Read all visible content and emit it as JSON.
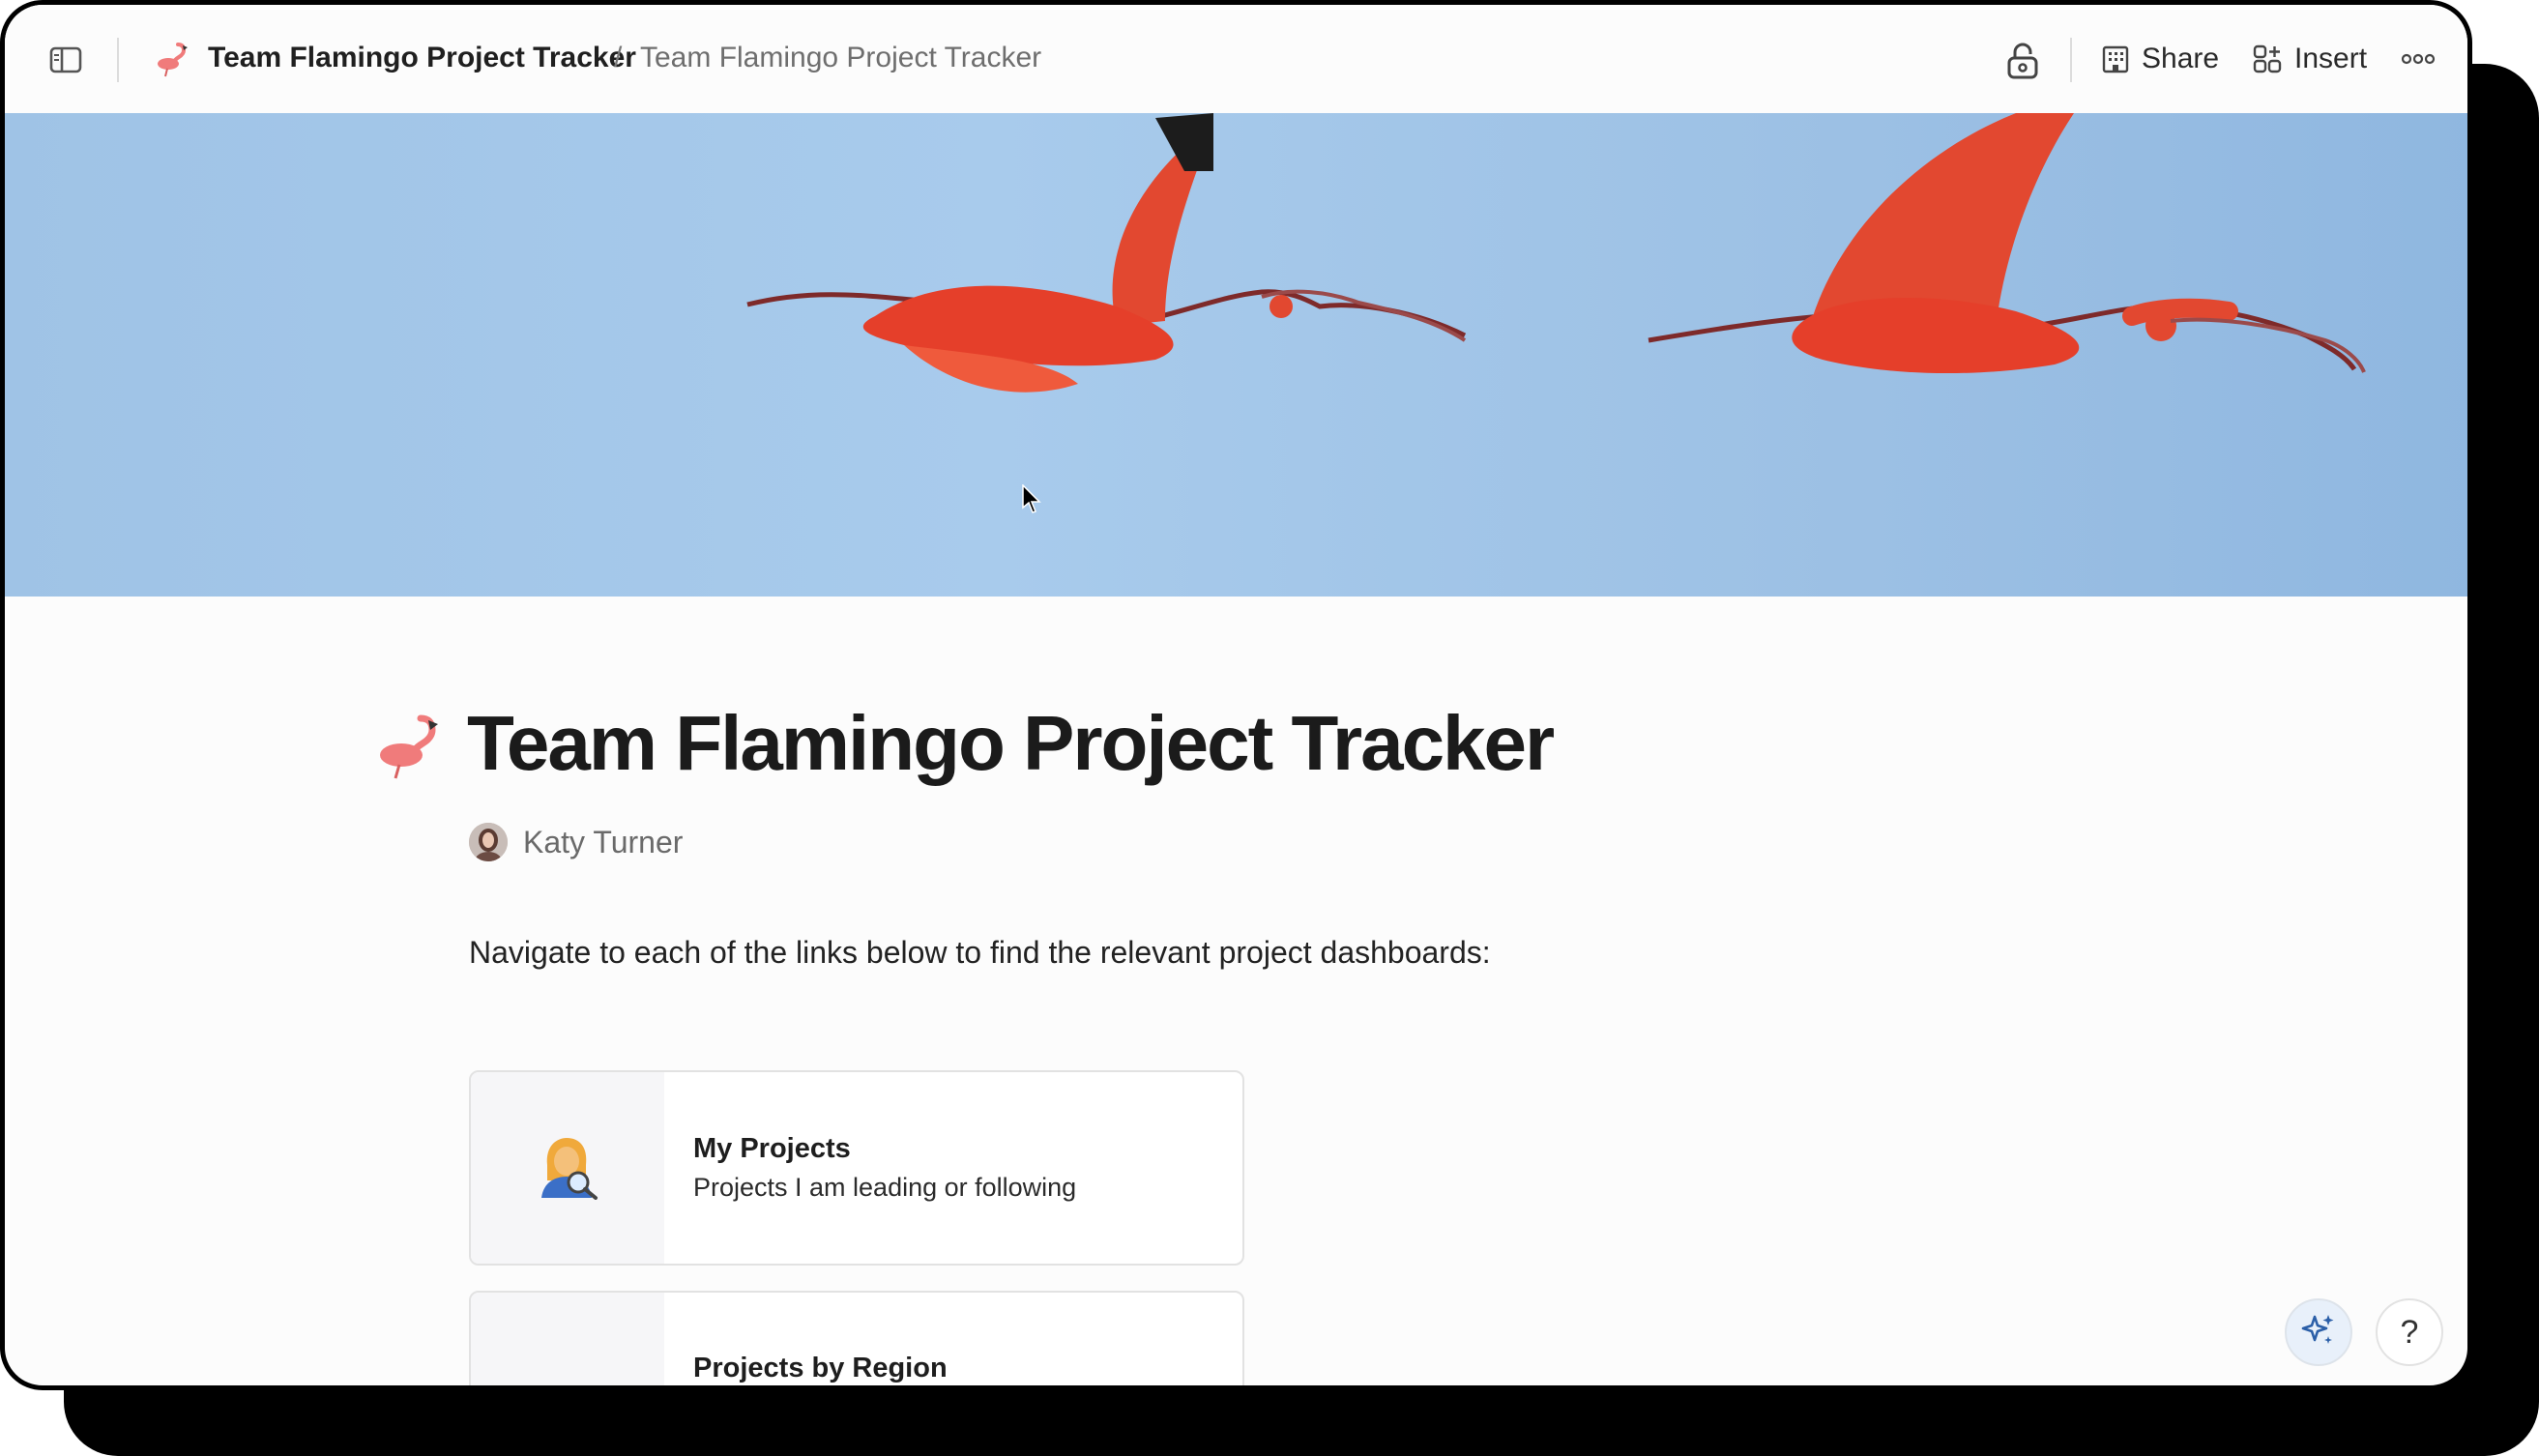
{
  "topbar": {
    "breadcrumb_title": "Team Flamingo Project Tracker",
    "breadcrumb_separator": "/",
    "breadcrumb_current": "Team Flamingo Project Tracker",
    "share_label": "Share",
    "insert_label": "Insert"
  },
  "page": {
    "title": "Team Flamingo Project Tracker",
    "author": "Katy Turner",
    "intro": "Navigate to each of the links below to find the relevant project dashboards:"
  },
  "cards": [
    {
      "title": "My Projects",
      "description": "Projects I am leading or following",
      "icon": "woman-detective-icon"
    },
    {
      "title": "Projects by Region",
      "description": "",
      "icon": "globe-icon"
    }
  ],
  "floating": {
    "help_label": "?"
  },
  "colors": {
    "accent": "#2b5fa8",
    "banner": "#a8cbec",
    "bird": "#e8412c"
  }
}
